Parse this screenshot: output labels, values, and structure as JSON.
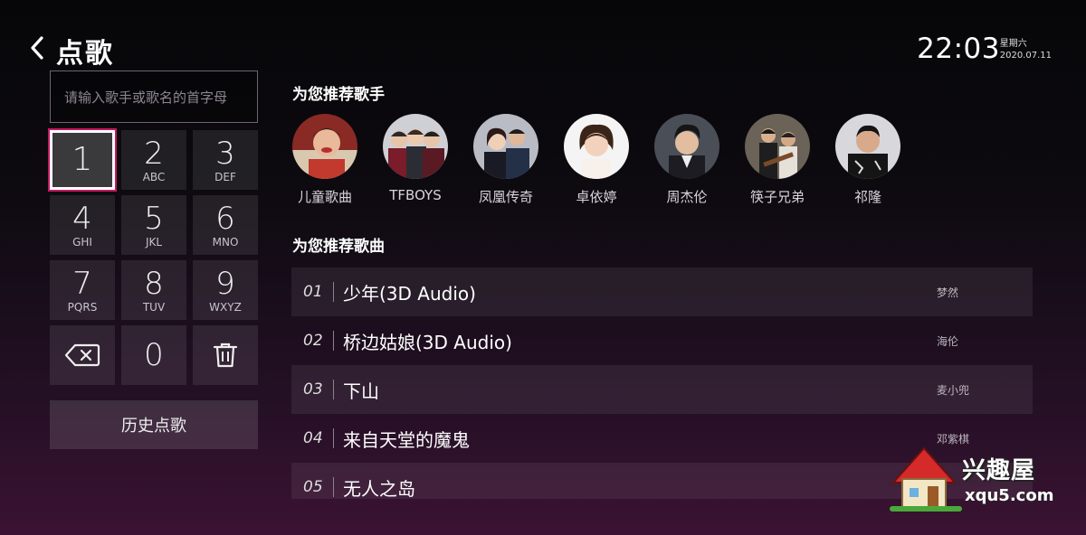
{
  "header": {
    "title": "点歌",
    "time": "22:03",
    "weekday": "星期六",
    "date": "2020.07.11"
  },
  "search": {
    "placeholder": "请输入歌手或歌名的首字母"
  },
  "keypad": {
    "keys": [
      {
        "num": "1",
        "sub": ""
      },
      {
        "num": "2",
        "sub": "ABC"
      },
      {
        "num": "3",
        "sub": "DEF"
      },
      {
        "num": "4",
        "sub": "GHI"
      },
      {
        "num": "5",
        "sub": "JKL"
      },
      {
        "num": "6",
        "sub": "MNO"
      },
      {
        "num": "7",
        "sub": "PQRS"
      },
      {
        "num": "8",
        "sub": "TUV"
      },
      {
        "num": "9",
        "sub": "WXYZ"
      },
      {
        "num": "0",
        "sub": ""
      }
    ],
    "history_label": "历史点歌"
  },
  "singers": {
    "section_title": "为您推荐歌手",
    "items": [
      {
        "name": "儿童歌曲"
      },
      {
        "name": "TFBOYS"
      },
      {
        "name": "凤凰传奇"
      },
      {
        "name": "卓依婷"
      },
      {
        "name": "周杰伦"
      },
      {
        "name": "筷子兄弟"
      },
      {
        "name": "祁隆"
      }
    ]
  },
  "songs": {
    "section_title": "为您推荐歌曲",
    "items": [
      {
        "index": "01",
        "title": "少年(3D Audio)",
        "artist": "梦然"
      },
      {
        "index": "02",
        "title": "桥边姑娘(3D Audio)",
        "artist": "海伦"
      },
      {
        "index": "03",
        "title": "下山",
        "artist": "麦小兜"
      },
      {
        "index": "04",
        "title": "来自天堂的魔鬼",
        "artist": "邓紫棋"
      },
      {
        "index": "05",
        "title": "无人之岛",
        "artist": ""
      }
    ]
  },
  "watermark": {
    "brand": "兴趣屋",
    "url": "xqu5.com"
  }
}
